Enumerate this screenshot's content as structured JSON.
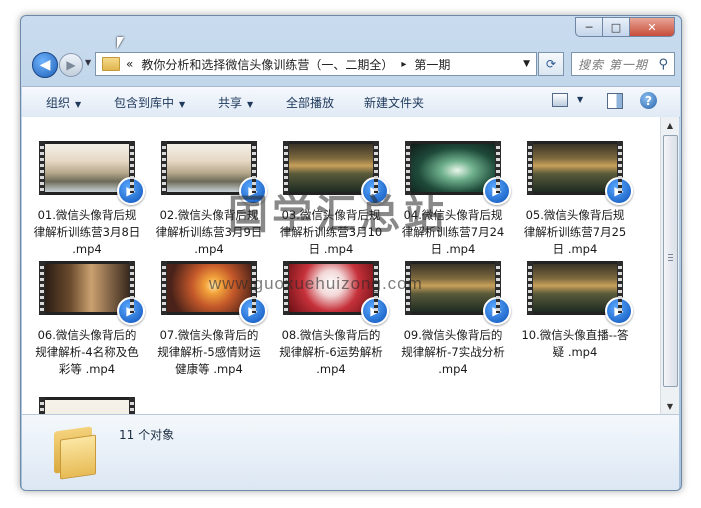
{
  "window": {
    "caption_buttons": {
      "minimize": "─",
      "maximize": "□",
      "close": "✕"
    }
  },
  "nav": {
    "back_glyph": "◀",
    "forward_glyph": "▶",
    "address": {
      "prefix": "«",
      "segment1": "教你分析和选择微信头像训练营（一、二期全）",
      "separator": "▸",
      "segment2": "第一期"
    },
    "search_placeholder": "搜索 第一期"
  },
  "toolbar": {
    "organize": "组织",
    "include_in_library": "包含到库中",
    "share": "共享",
    "play_all": "全部播放",
    "new_folder": "新建文件夹",
    "help": "?"
  },
  "files": [
    {
      "name": "01.微信头像背后规律解析训练营3月8日 .mp4",
      "thumb_style": "mountain-clouds"
    },
    {
      "name": "02.微信头像背后规律解析训练营3月9日 .mp4",
      "thumb_style": "mountain-clouds"
    },
    {
      "name": "03.微信头像背后规律解析训练营3月10日 .mp4",
      "thumb_style": "dusk-landscape"
    },
    {
      "name": "04.微信头像背后规律解析训练营7月24日 .mp4",
      "thumb_style": "green-burst"
    },
    {
      "name": "05.微信头像背后规律解析训练营7月25日 .mp4",
      "thumb_style": "dusk-landscape"
    },
    {
      "name": "06.微信头像背后的规律解析-4名称及色彩等 .mp4",
      "thumb_style": "classroom"
    },
    {
      "name": "07.微信头像背后的规律解析-5感情财运健康等 .mp4",
      "thumb_style": "sunset"
    },
    {
      "name": "08.微信头像背后的规律解析-6运势解析 .mp4",
      "thumb_style": "red-blossom"
    },
    {
      "name": "09.微信头像背后的规律解析-7实战分析 .mp4",
      "thumb_style": "dusk-landscape"
    },
    {
      "name": "10.微信头像直播--答疑 .mp4",
      "thumb_style": "dusk-landscape"
    },
    {
      "name": "",
      "thumb_style": "calligraphy"
    }
  ],
  "details": {
    "count": "11 个对象"
  },
  "watermark": {
    "line1": "国学汇总站",
    "line2": "www.guoxuehuizong.com"
  },
  "icons": [
    "folder-icon",
    "play-badge-icon",
    "search-icon",
    "refresh-icon",
    "help-icon"
  ]
}
